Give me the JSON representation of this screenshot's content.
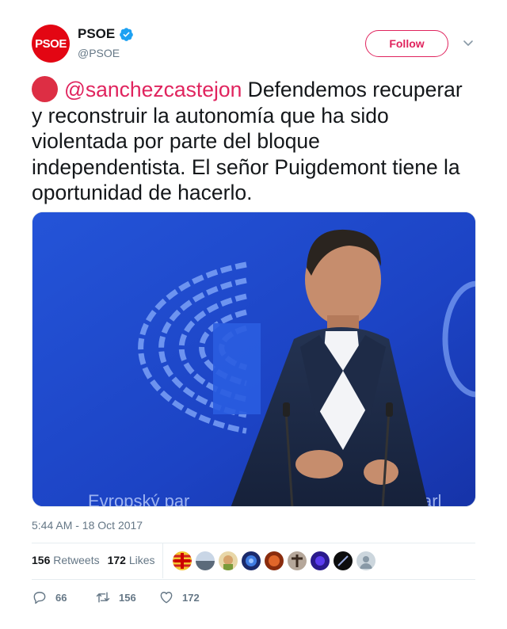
{
  "account": {
    "display_name": "PSOE",
    "handle": "@PSOE",
    "avatar_text": "PSOE"
  },
  "follow_label": "Follow",
  "tweet": {
    "mention": "@sanchezcastejon",
    "body": " Defendemos recuperar y reconstruir la autonomía que ha sido violentada por parte del bloque independentista. El señor Puigdemont tiene la oportunidad de hacerlo."
  },
  "media": {
    "banner_text": "Evropský par",
    "banner_text_right": "-Parl"
  },
  "timestamp": "5:44 AM - 18 Oct 2017",
  "stats": {
    "retweets_count": "156",
    "retweets_label": "Retweets",
    "likes_count": "172",
    "likes_label": "Likes"
  },
  "actions": {
    "reply_count": "66",
    "retweet_count": "156",
    "like_count": "172"
  },
  "colors": {
    "brand_red": "#e30613",
    "accent": "#e0245e",
    "verified_blue": "#1da1f2",
    "muted": "#657786"
  },
  "icons": [
    "verified-badge-icon",
    "chevron-down-icon",
    "reply-icon",
    "retweet-icon",
    "heart-icon"
  ]
}
